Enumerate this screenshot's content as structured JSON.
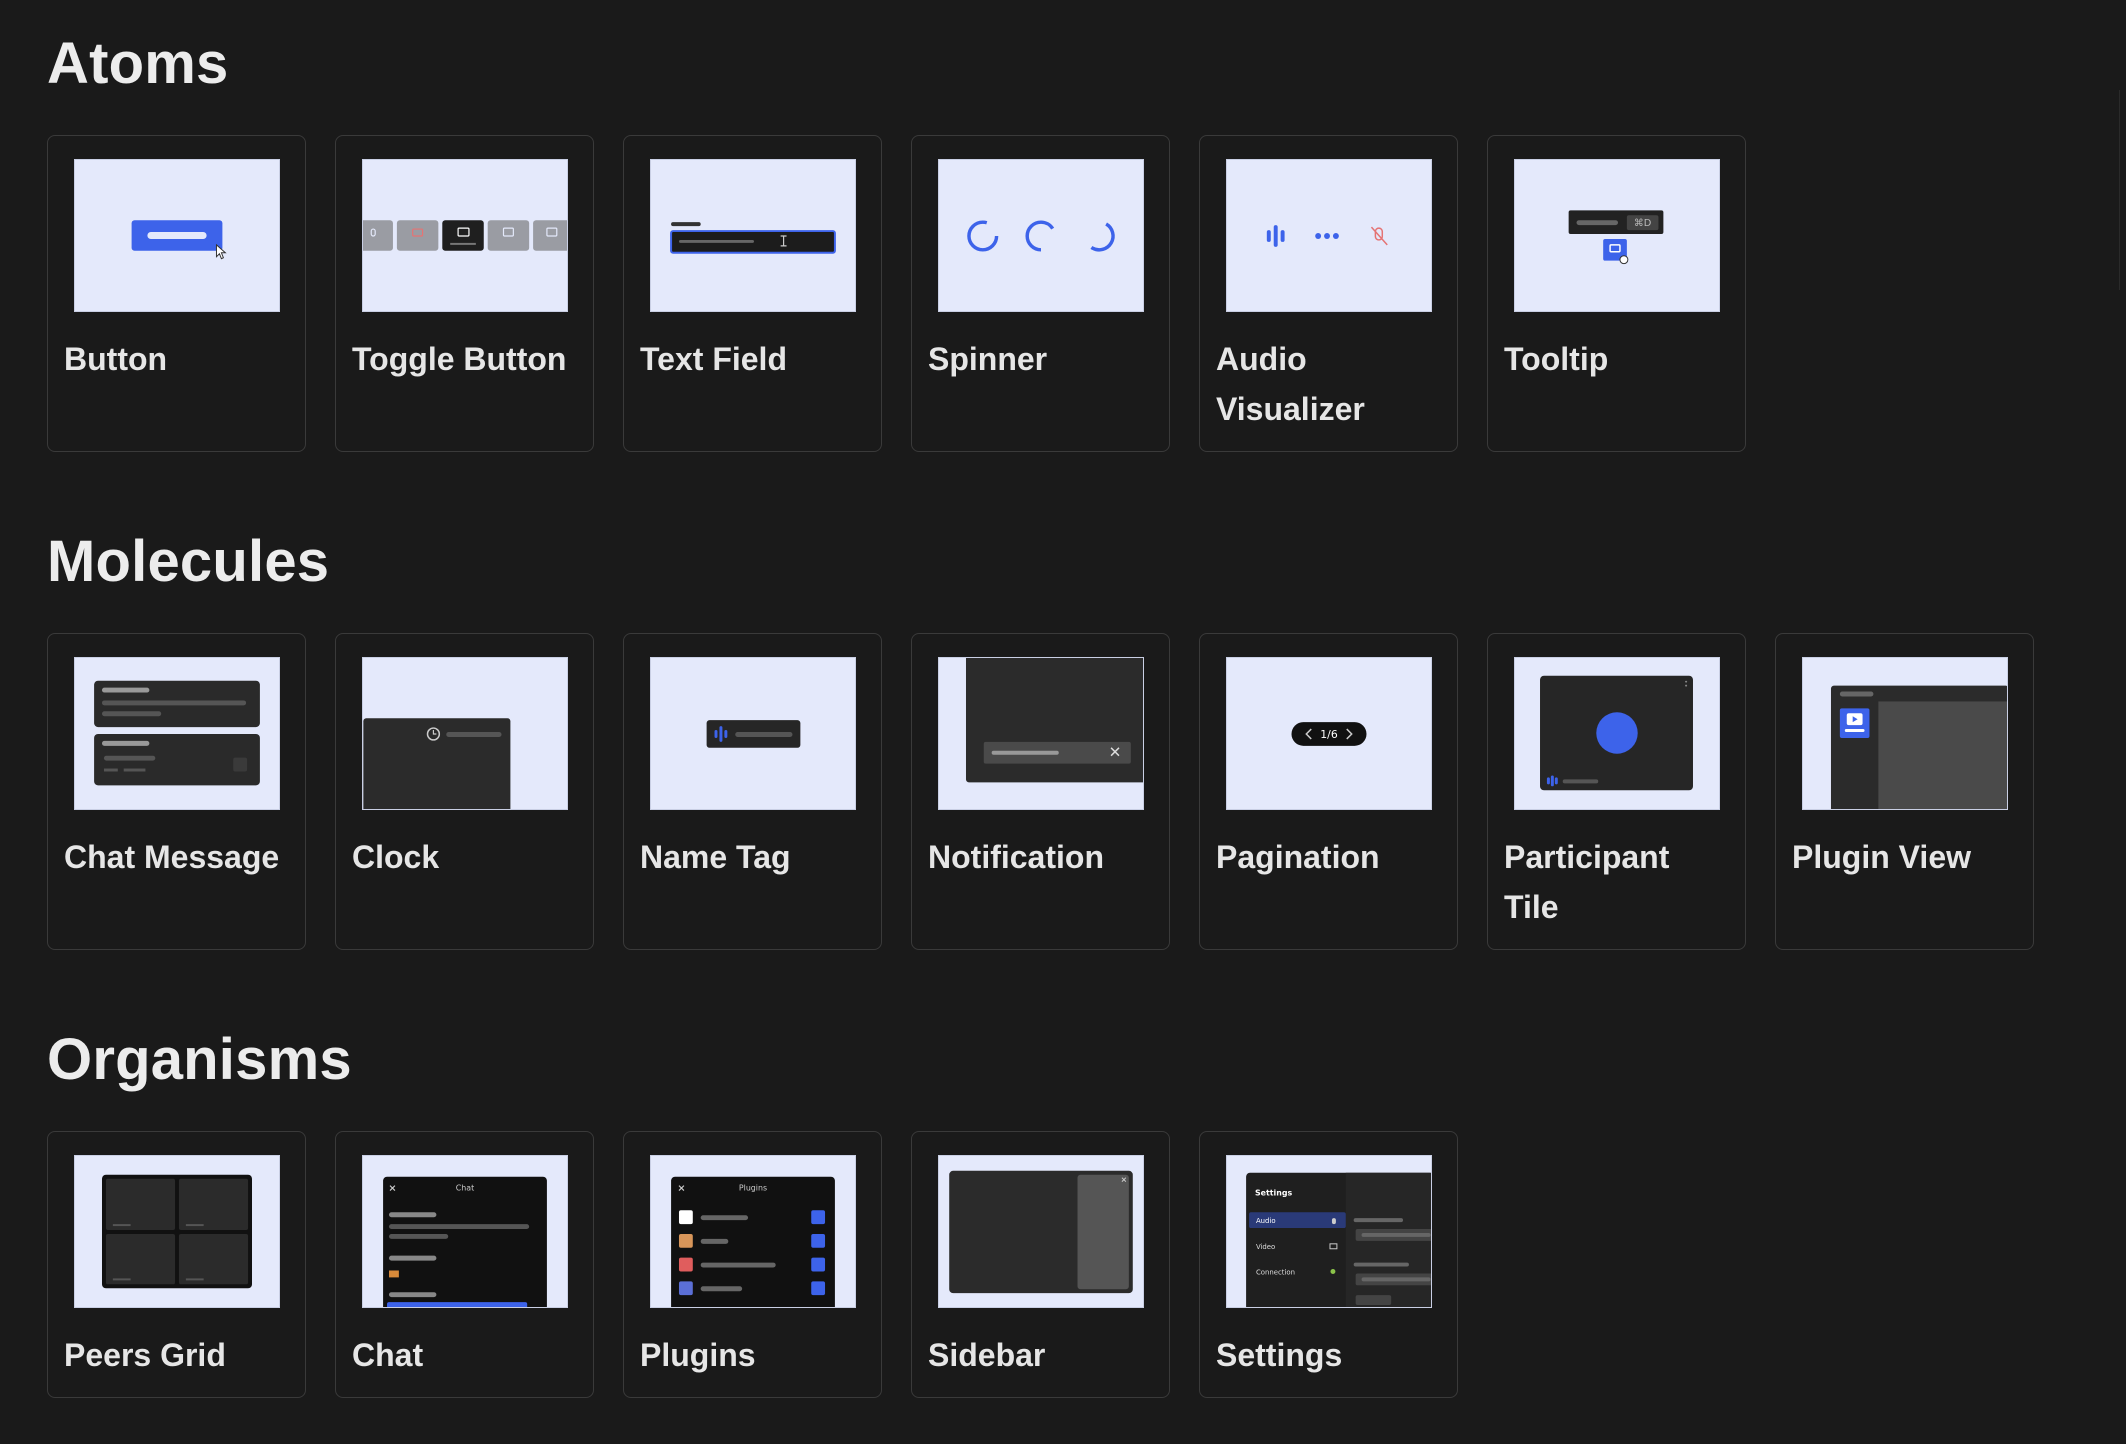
{
  "sections": [
    {
      "title": "Atoms",
      "items": [
        {
          "label": "Button"
        },
        {
          "label": "Toggle Button"
        },
        {
          "label": "Text Field"
        },
        {
          "label": "Spinner"
        },
        {
          "label": "Audio Visualizer"
        },
        {
          "label": "Tooltip",
          "shortcut": "⌘D"
        }
      ]
    },
    {
      "title": "Molecules",
      "items": [
        {
          "label": "Chat Message"
        },
        {
          "label": "Clock"
        },
        {
          "label": "Name Tag"
        },
        {
          "label": "Notification"
        },
        {
          "label": "Pagination",
          "page": "1/6"
        },
        {
          "label": "Participant Tile"
        },
        {
          "label": "Plugin View"
        }
      ]
    },
    {
      "title": "Organisms",
      "items": [
        {
          "label": "Peers Grid"
        },
        {
          "label": "Chat",
          "panel_title": "Chat"
        },
        {
          "label": "Plugins",
          "panel_title": "Plugins"
        },
        {
          "label": "Sidebar"
        },
        {
          "label": "Settings",
          "panel_title": "Settings",
          "menu": [
            "Audio",
            "Video",
            "Connection"
          ]
        }
      ]
    }
  ],
  "colors": {
    "background": "#1a1a1a",
    "thumb_bg": "#e4e9fb",
    "accent": "#3d63ea",
    "dark_panel": "#2b2b2b",
    "card_border": "#3a3a3a"
  }
}
